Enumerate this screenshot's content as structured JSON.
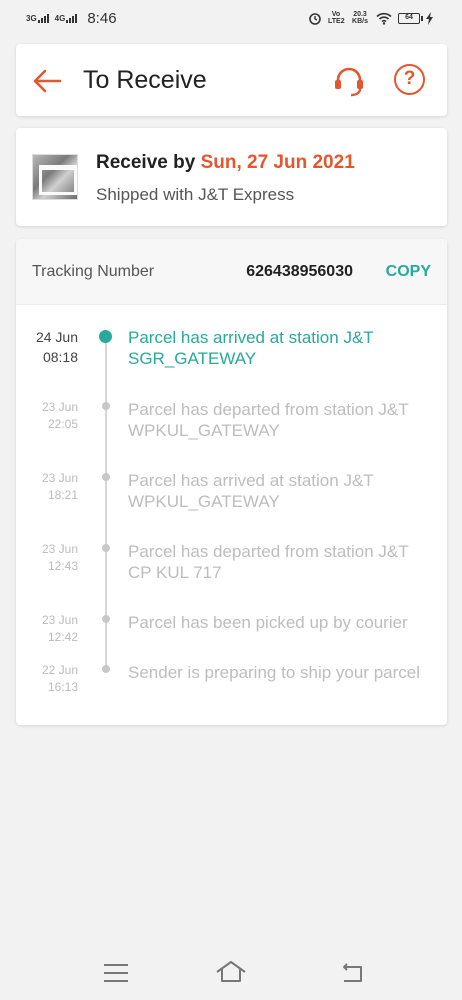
{
  "status_bar": {
    "network1": "3G",
    "network2": "4G",
    "time": "8:46",
    "volte": "Vo LTE2",
    "speed": "20.3 KB/s",
    "battery": "64"
  },
  "header": {
    "title": "To Receive",
    "accent_color": "#e4572e"
  },
  "delivery": {
    "receive_prefix": "Receive by ",
    "receive_date": "Sun, 27 Jun 2021",
    "shipped_with": "Shipped with J&T Express"
  },
  "tracking": {
    "label": "Tracking Number",
    "number": "626438956030",
    "copy_label": "COPY",
    "accent_color": "#26aa99",
    "events": [
      {
        "day": "24 Jun",
        "time": "08:18",
        "text": "Parcel has arrived at station J&T SGR_GATEWAY"
      },
      {
        "day": "23 Jun",
        "time": "22:05",
        "text": "Parcel has departed from station J&T WPKUL_GATEWAY"
      },
      {
        "day": "23 Jun",
        "time": "18:21",
        "text": "Parcel has arrived at station J&T WPKUL_GATEWAY"
      },
      {
        "day": "23 Jun",
        "time": "12:43",
        "text": "Parcel has departed from station J&T CP KUL 717"
      },
      {
        "day": "23 Jun",
        "time": "12:42",
        "text": "Parcel has been picked up by courier"
      },
      {
        "day": "22 Jun",
        "time": "16:13",
        "text": "Sender is preparing to ship your parcel"
      }
    ]
  }
}
